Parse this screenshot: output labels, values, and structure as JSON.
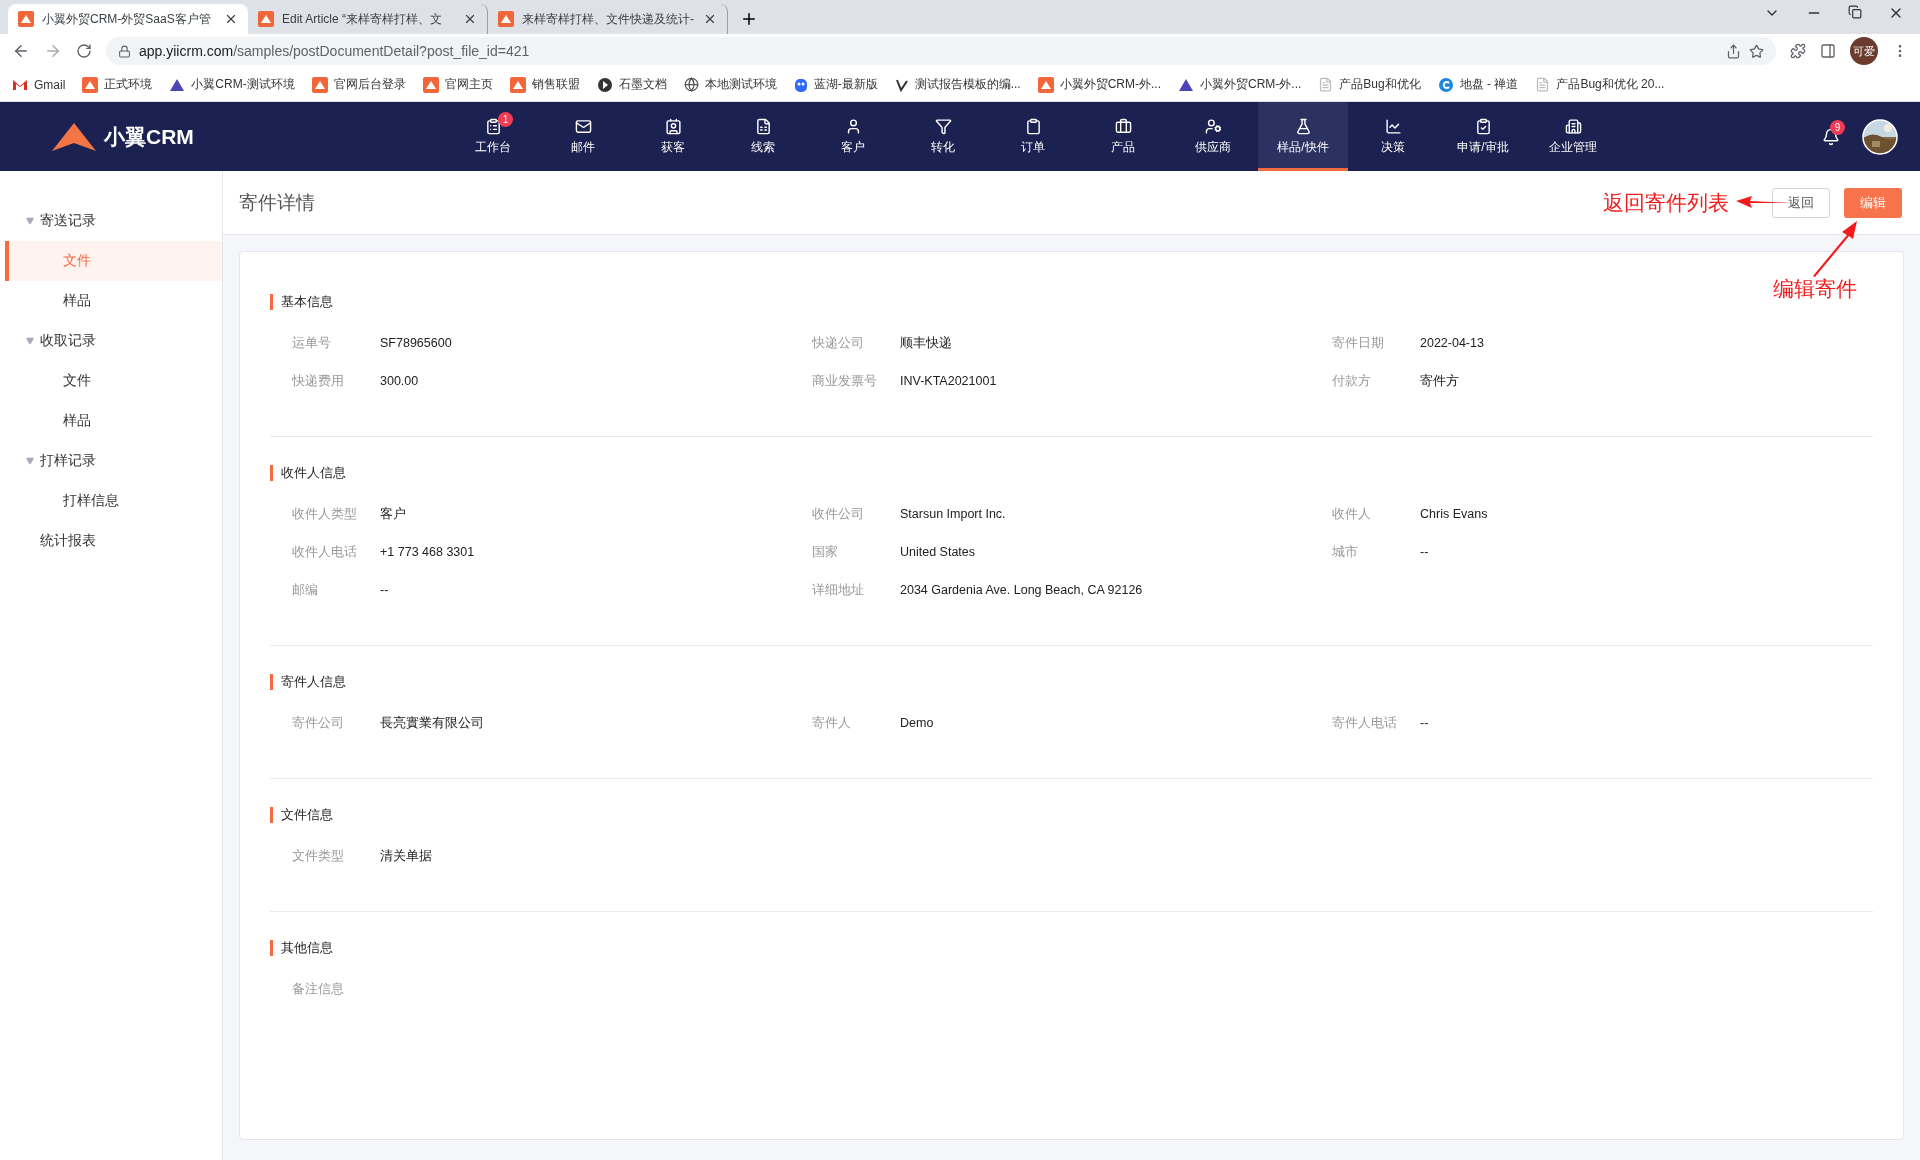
{
  "browser": {
    "tabs": [
      {
        "title": "小翼外贸CRM-外贸SaaS客户管",
        "selected": true
      },
      {
        "title": "Edit Article “来样寄样打样、文",
        "selected": false
      },
      {
        "title": "来样寄样打样、文件快递及统计-",
        "selected": false
      }
    ],
    "url_host": "app.yiicrm.com",
    "url_path": "/samples/postDocumentDetail?post_file_id=421",
    "profile": "可爱",
    "bookmarks": [
      "Gmail",
      "正式环境",
      "小翼CRM-测试环境",
      "官网后台登录",
      "官网主页",
      "销售联盟",
      "石墨文档",
      "本地测试环境",
      "蓝湖-最新版",
      "测试报告模板的编...",
      "小翼外贸CRM-外...",
      "小翼外贸CRM-外...",
      "产品Bug和优化",
      "地盘 - 禅道",
      "产品Bug和优化 20..."
    ]
  },
  "app": {
    "logo": "小翼CRM",
    "bell_badge": "9",
    "nav": [
      {
        "label": "工作台",
        "selected": false,
        "badge": "1"
      },
      {
        "label": "邮件",
        "selected": false
      },
      {
        "label": "获客",
        "selected": false
      },
      {
        "label": "线索",
        "selected": false
      },
      {
        "label": "客户",
        "selected": false
      },
      {
        "label": "转化",
        "selected": false
      },
      {
        "label": "订单",
        "selected": false
      },
      {
        "label": "产品",
        "selected": false
      },
      {
        "label": "供应商",
        "selected": false
      },
      {
        "label": "样品/快件",
        "selected": true
      },
      {
        "label": "决策",
        "selected": false
      },
      {
        "label": "申请/审批",
        "selected": false
      },
      {
        "label": "企业管理",
        "selected": false
      }
    ]
  },
  "sidebar": [
    {
      "label": "寄送记录",
      "expanded": true,
      "children": [
        {
          "label": "文件",
          "selected": true
        },
        {
          "label": "样品",
          "selected": false
        }
      ]
    },
    {
      "label": "收取记录",
      "expanded": true,
      "children": [
        {
          "label": "文件",
          "selected": false
        },
        {
          "label": "样品",
          "selected": false
        }
      ]
    },
    {
      "label": "打样记录",
      "expanded": true,
      "children": [
        {
          "label": "打样信息",
          "selected": false
        }
      ]
    },
    {
      "label": "统计报表"
    }
  ],
  "page": {
    "title": "寄件详情",
    "back_button": "返回",
    "edit_button": "编辑",
    "back_note": "返回寄件列表",
    "edit_note": "编辑寄件"
  },
  "sections": [
    {
      "title": "基本信息",
      "fields": [
        {
          "label": "运单号",
          "value": "SF78965600"
        },
        {
          "label": "快递公司",
          "value": "顺丰快递"
        },
        {
          "label": "寄件日期",
          "value": "2022-04-13"
        },
        {
          "label": "快递费用",
          "value": "300.00"
        },
        {
          "label": "商业发票号",
          "value": "INV-KTA2021001"
        },
        {
          "label": "付款方",
          "value": "寄件方"
        }
      ]
    },
    {
      "title": "收件人信息",
      "fields": [
        {
          "label": "收件人类型",
          "value": "客户"
        },
        {
          "label": "收件公司",
          "value": "Starsun Import Inc."
        },
        {
          "label": "收件人",
          "value": "Chris Evans"
        },
        {
          "label": "收件人电话",
          "value": "+1 773 468 3301"
        },
        {
          "label": "国家",
          "value": "United States"
        },
        {
          "label": "城市",
          "value": "--"
        },
        {
          "label": "邮编",
          "value": "--"
        },
        {
          "label": "详细地址",
          "value": "2034 Gardenia Ave. Long Beach, CA 92126"
        }
      ]
    },
    {
      "title": "寄件人信息",
      "fields": [
        {
          "label": "寄件公司",
          "value": "長亮實業有限公司"
        },
        {
          "label": "寄件人",
          "value": "Demo"
        },
        {
          "label": "寄件人电话",
          "value": "--"
        }
      ]
    },
    {
      "title": "文件信息",
      "fields": [
        {
          "label": "文件类型",
          "value": "清关单据"
        }
      ]
    },
    {
      "title": "其他信息",
      "fields": [
        {
          "label": "备注信息"
        }
      ]
    }
  ]
}
